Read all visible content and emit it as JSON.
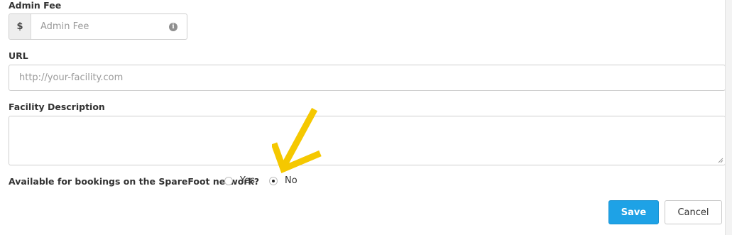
{
  "admin_fee": {
    "label": "Admin Fee",
    "prefix": "$",
    "placeholder": "Admin Fee",
    "info_icon_glyph": "i"
  },
  "url": {
    "label": "URL",
    "placeholder": "http://your-facility.com"
  },
  "description": {
    "label": "Facility Description",
    "value": ""
  },
  "network_bookings": {
    "question": "Available for bookings on the SpareFoot network?",
    "options": [
      {
        "label": "Yes",
        "selected": false
      },
      {
        "label": "No",
        "selected": true
      }
    ]
  },
  "buttons": {
    "save_label": "Save",
    "cancel_label": "Cancel"
  },
  "colors": {
    "primary": "#1ea2e6",
    "annotation_arrow": "#f5c800"
  },
  "annotation": {
    "icon": "arrow-down-left-icon"
  }
}
